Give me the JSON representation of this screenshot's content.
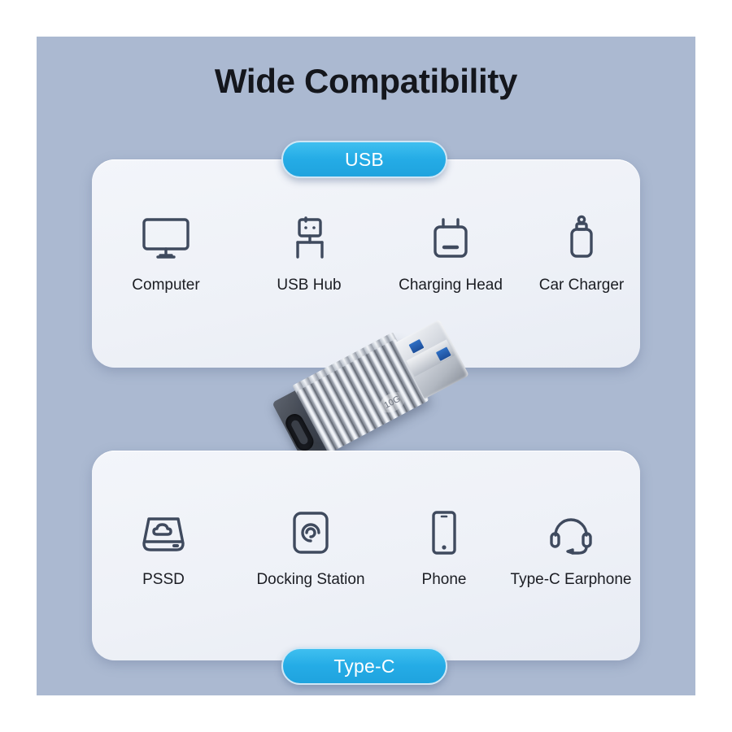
{
  "page": {
    "title": "Wide Compatibility",
    "background_color": "#abb9d1",
    "card_color": "#eef1f7",
    "accent_color": "#25ace6",
    "icon_color": "#3f4a5e",
    "text_color": "#1b1d23"
  },
  "usb_section": {
    "badge_label": "USB",
    "items": [
      {
        "label": "Computer",
        "icon": "monitor-icon"
      },
      {
        "label": "USB Hub",
        "icon": "usb-connector-icon"
      },
      {
        "label": "Charging Head",
        "icon": "wall-charger-icon"
      },
      {
        "label": "Car Charger",
        "icon": "car-charger-icon"
      }
    ]
  },
  "typec_section": {
    "badge_label": "Type-C",
    "items": [
      {
        "label": "PSSD",
        "icon": "portable-ssd-cloud-icon"
      },
      {
        "label": "Docking Station",
        "icon": "docking-station-icon"
      },
      {
        "label": "Phone",
        "icon": "smartphone-icon"
      },
      {
        "label": "Type-C Earphone",
        "icon": "headset-icon"
      }
    ]
  },
  "product": {
    "name": "usb-a-to-usb-c-adapter",
    "speed_marking": "10G"
  }
}
